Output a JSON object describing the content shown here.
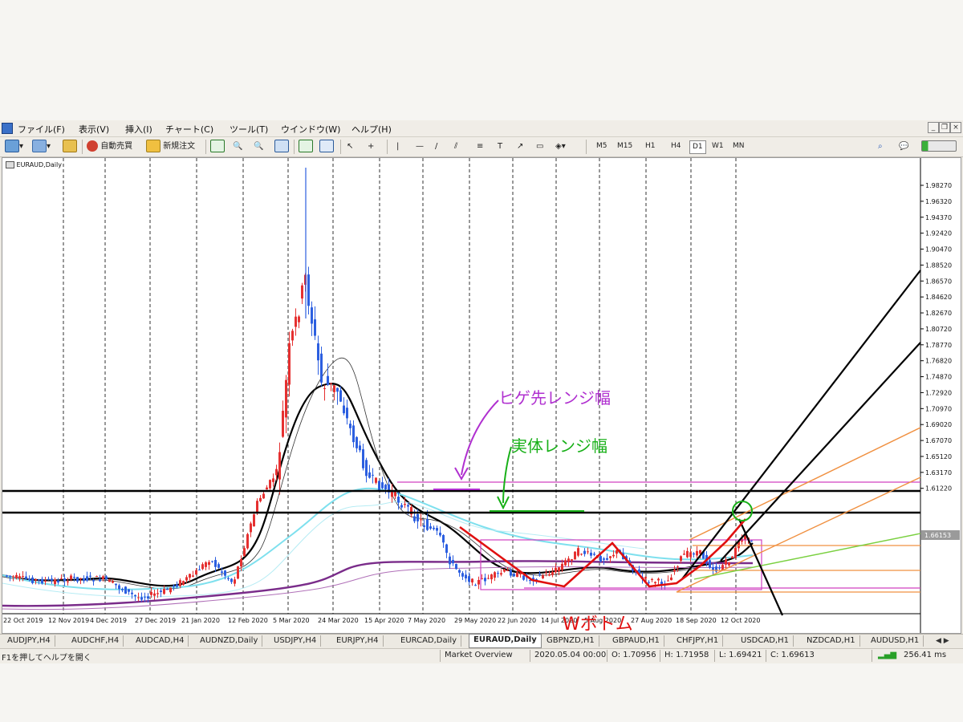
{
  "menu": {
    "items": [
      "ファイル(F)",
      "表示(V)",
      "挿入(I)",
      "チャート(C)",
      "ツール(T)",
      "ウインドウ(W)",
      "ヘルプ(H)"
    ]
  },
  "toolbar": {
    "auto_trade_label": "自動売買",
    "new_order_label": "新規注文",
    "timeframes": [
      "M5",
      "M15",
      "H1",
      "H4",
      "D1",
      "W1",
      "MN"
    ],
    "active_timeframe": "D1"
  },
  "chart": {
    "symbol_label": "EURAUD,Daily",
    "current_price": "1.66153",
    "price_labels": [
      "1.98270",
      "1.96320",
      "1.94370",
      "1.92420",
      "1.90470",
      "1.88520",
      "1.86570",
      "1.84620",
      "1.82670",
      "1.80720",
      "1.78770",
      "1.76820",
      "1.74870",
      "1.72920",
      "1.70970",
      "1.69020",
      "1.67070",
      "1.65120",
      "1.63170",
      "1.61220"
    ],
    "date_labels": [
      "22 Oct 2019",
      "12 Nov 2019",
      "4 Dec 2019",
      "27 Dec 2019",
      "21 Jan 2020",
      "12 Feb 2020",
      "5 Mar 2020",
      "24 Mar 2020",
      "15 Apr 2020",
      "7 May 2020",
      "29 May 2020",
      "22 Jun 2020",
      "14 Jul 2020",
      "5 Aug 2020",
      "27 Aug 2020",
      "18 Sep 2020",
      "12 Oct 2020"
    ],
    "annotations": {
      "wick_range": "ヒゲ先レンジ幅",
      "body_range": "実体レンジ幅",
      "w_bottom": "Wボトム"
    },
    "colors": {
      "up_candle": "#e53030",
      "down_candle": "#2c5fe0",
      "ma_fast": "#000000",
      "ma_cyan": "#7ee0ee",
      "ma_purple": "#7a2c8a",
      "magenta": "#d040c0",
      "green": "#18b018",
      "orange": "#f09040",
      "red_pattern": "#e01010"
    }
  },
  "tabs": {
    "items": [
      "AUDJPY,H4",
      "AUDCHF,H4",
      "AUDCAD,H4",
      "AUDNZD,Daily",
      "USDJPY,H4",
      "EURJPY,H4",
      "EURCAD,Daily",
      "EURAUD,Daily",
      "GBPNZD,H1",
      "GBPAUD,H1",
      "CHFJPY,H1",
      "USDCAD,H1",
      "NZDCAD,H1",
      "AUDUSD,H1"
    ],
    "active": "EURAUD,Daily",
    "arrows": "◀ ▶"
  },
  "status": {
    "help_text": "F1を押してヘルプを開く",
    "profile": "Market Overview",
    "datetime": "2020.05.04 00:00",
    "open": "O: 1.70956",
    "high": "H: 1.71958",
    "low": "L: 1.69421",
    "close": "C: 1.69613",
    "ping": "256.41 ms"
  }
}
